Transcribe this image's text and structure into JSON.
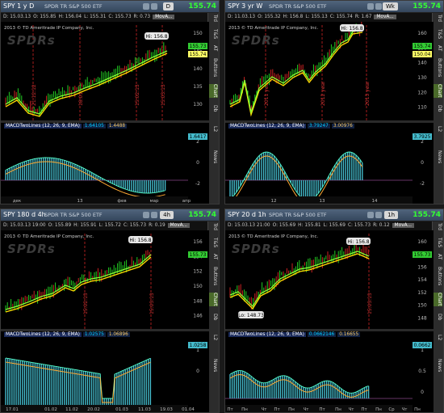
{
  "panels": [
    {
      "symbol": "SPY 1 y D",
      "description": "SPDR TR S&P 500 ETF",
      "timeframe": "D",
      "price": "155.74",
      "quote": {
        "date": "D: 15.03.13",
        "open": "O: 155.85",
        "high": "H: 156.04",
        "low": "L: 155.31",
        "close": "C: 155.73",
        "range": "R: 0.73",
        "menu": "MovA..."
      },
      "copyright": "2013 © TD Ameritrade IP Company, Inc.",
      "logo": "SPDRs",
      "side_tabs": [
        "Trd",
        "T&S",
        "AT",
        "Buttons",
        "Chart",
        "Db",
        "L2",
        "News"
      ],
      "active_tab": "Chart",
      "hi_label": "Hi: 156.8",
      "price_badges": [
        {
          "text": "155.73",
          "color": "#33cc33"
        },
        {
          "text": "155.74",
          "color": "#ffff66"
        }
      ],
      "y_ticks": [
        "150",
        "145",
        "140",
        "135",
        "130"
      ],
      "date_markers": [
        "21.12.12",
        "18.01.13",
        "15.02.13",
        "15.03.13"
      ],
      "x_ticks": [
        "дек",
        "13",
        "фев",
        "мар",
        "апр"
      ],
      "macd": {
        "name": "MACDTwoLines (12, 26, 9, EMA)",
        "v1": "1.64105",
        "v2": "1.4488",
        "badge": "1.6417"
      },
      "macd_ticks": [
        "2",
        "0",
        "-2"
      ]
    },
    {
      "symbol": "SPY 3 yr W",
      "description": "SPDR TR S&P 500 ETF",
      "timeframe": "Wk",
      "price": "155.74",
      "quote": {
        "date": "D: 11.03.13",
        "open": "O: 155.32",
        "high": "H: 156.8",
        "low": "L: 155.13",
        "close": "C: 155.74",
        "range": "R: 1.67",
        "menu": "MovA..."
      },
      "copyright": "2013 © TD Ameritrade IP Company, Inc.",
      "logo": "SPDRs",
      "side_tabs": [
        "Trd",
        "T&S",
        "AT",
        "Buttons",
        "Chart",
        "Db",
        "L2",
        "News"
      ],
      "active_tab": "Chart",
      "hi_label": "Hi: 156.8",
      "price_badges": [
        {
          "text": "155.74",
          "color": "#33cc33"
        },
        {
          "text": "150.04",
          "color": "#ffff66"
        }
      ],
      "y_ticks": [
        "160",
        "150",
        "140",
        "130",
        "120",
        "110"
      ],
      "date_markers": [
        "2011 year",
        "2012 year",
        "2013 year"
      ],
      "x_ticks": [
        "12",
        "13",
        "14"
      ],
      "macd": {
        "name": "MACDTwoLines (12, 26, 9, EMA)",
        "v1": "3.79247",
        "v2": "3.00976",
        "badge": "3.7925"
      },
      "macd_ticks": [
        "2",
        "0",
        "-2"
      ]
    },
    {
      "symbol": "SPY 180 d 4h",
      "description": "SPDR TR S&P 500 ETF",
      "timeframe": "4h",
      "price": "155.74",
      "quote": {
        "date": "D: 15.03.13 19:00",
        "open": "O: 155.89",
        "high": "H: 155.91",
        "low": "L: 155.72",
        "close": "C: 155.73",
        "range": "R: 0.19",
        "menu": "MovA..."
      },
      "copyright": "2013 © TD Ameritrade IP Company, Inc.",
      "logo": "SPDRs",
      "side_tabs": [
        "Trd",
        "T&S",
        "AT",
        "Buttons",
        "Chart",
        "Db",
        "L2",
        "News"
      ],
      "active_tab": "Chart",
      "hi_label": "Hi: 156.8",
      "price_badges": [
        {
          "text": "155.73",
          "color": "#33cc33"
        }
      ],
      "y_ticks": [
        "156",
        "154",
        "152",
        "150",
        "148",
        "146"
      ],
      "date_markers": [
        "15.02.13",
        "15.03.13"
      ],
      "x_ticks": [
        "17.01",
        "01.02",
        "11.02",
        "20.02",
        "01.03",
        "11.03",
        "19.03",
        "01.04"
      ],
      "macd": {
        "name": "MACDTwoLines (12, 26, 9, EMA)",
        "v1": "1.02575",
        "v2": "1.06896",
        "badge": "1.0258"
      },
      "macd_ticks": [
        "1",
        "0"
      ]
    },
    {
      "symbol": "SPY 20 d 1h",
      "description": "SPDR TR S&P 500 ETF",
      "timeframe": "1h",
      "price": "155.74",
      "quote": {
        "date": "D: 15.03.13 21:00",
        "open": "O: 155.69",
        "high": "H: 155.81",
        "low": "L: 155.69",
        "close": "C: 155.73",
        "range": "R: 0.12",
        "menu": "MovA..."
      },
      "copyright": "2013 © TD Ameritrade IP Company, Inc.",
      "logo": "SPDRs",
      "side_tabs": [
        "Trd",
        "T&S",
        "AT",
        "Buttons",
        "Chart",
        "Db",
        "L2",
        "News"
      ],
      "active_tab": "Chart",
      "hi_label": "Hi: 156.8",
      "lo_label": "Lo: 148.73",
      "price_badges": [
        {
          "text": "155.73",
          "color": "#33cc33"
        }
      ],
      "y_ticks": [
        "160",
        "158",
        "156",
        "154",
        "152",
        "150",
        "148"
      ],
      "date_markers": [
        "15.03.13"
      ],
      "x_ticks": [
        "Пт",
        "Пн",
        "Чт",
        "Пт",
        "Пн",
        "Чт",
        "Пт",
        "Пн",
        "Чт",
        "Пт",
        "Пн",
        "Ср",
        "Чт",
        "Пн"
      ],
      "macd": {
        "name": "MACDTwoLines (12, 26, 9, EMA)",
        "v1": "0.0662146",
        "v2": "0.16655",
        "badge": "0.0662"
      },
      "macd_ticks": [
        "1",
        "0.5",
        "0"
      ]
    }
  ]
}
